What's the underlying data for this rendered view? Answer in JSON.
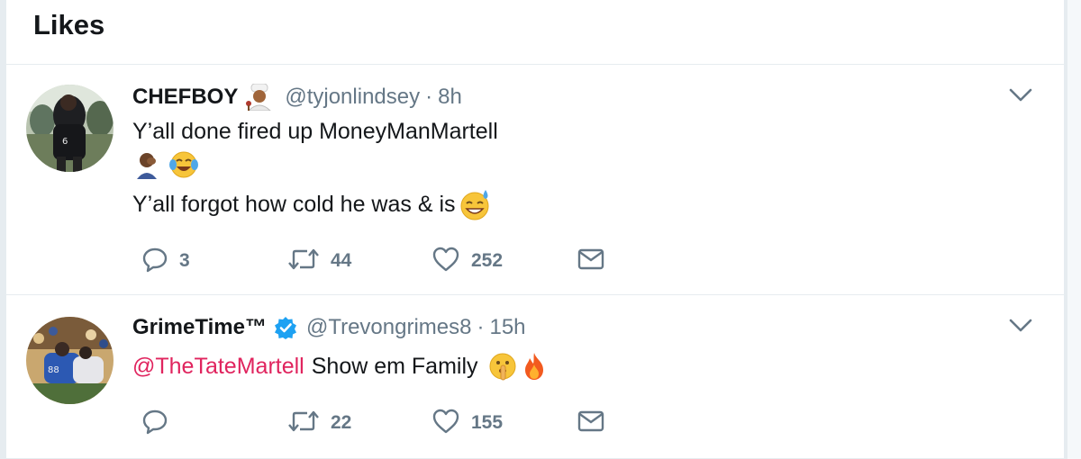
{
  "page": {
    "title": "Likes"
  },
  "tweets": [
    {
      "name": "CHEFBOY",
      "handle": "@tyjonlindsey",
      "separator": "·",
      "time": "8h",
      "lines": [
        "Y’all done fired up MoneyManMartell",
        "Y’all forgot how cold he was & is"
      ],
      "emojis": [
        "man-cook-emoji",
        "facepalm-emoji",
        "tears-of-joy-emoji",
        "sweat-smile-emoji"
      ],
      "replies": "3",
      "retweets": "44",
      "likes": "252"
    },
    {
      "name": "GrimeTime™",
      "handle": "@Trevongrimes8",
      "separator": "·",
      "time": "15h",
      "mention": "@TheTateMartell",
      "text": "Show em Family",
      "emojis": [
        "shushing-face-emoji",
        "fire-emoji"
      ],
      "verified": true,
      "replies": "",
      "retweets": "22",
      "likes": "155"
    }
  ],
  "colors": {
    "text": "#14171a",
    "secondary": "#657786",
    "mention": "#e0245e",
    "verified": "#1da1f2",
    "border": "#e6ecf0"
  }
}
